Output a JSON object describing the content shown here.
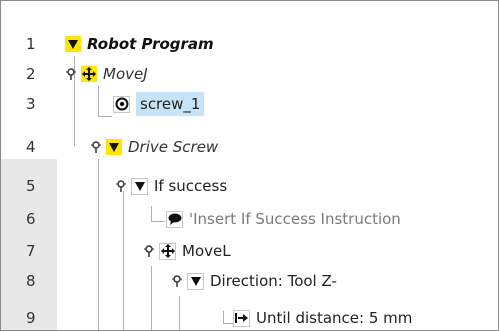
{
  "tree": {
    "rows": [
      {
        "num": "1",
        "label": "Robot Program",
        "icon": "triangle-down-icon"
      },
      {
        "num": "2",
        "label": "MoveJ",
        "icon": "move-arrows-icon"
      },
      {
        "num": "3",
        "label": "screw_1",
        "icon": "waypoint-icon"
      },
      {
        "num": "4",
        "label": "Drive Screw",
        "icon": "triangle-down-icon"
      },
      {
        "num": "5",
        "label": "If success",
        "icon": "triangle-down-icon"
      },
      {
        "num": "6",
        "label": "'Insert If Success Instruction",
        "icon": "comment-icon"
      },
      {
        "num": "7",
        "label": "MoveL",
        "icon": "move-arrows-icon"
      },
      {
        "num": "8",
        "label": "Direction: Tool Z-",
        "icon": "triangle-down-icon"
      },
      {
        "num": "9",
        "label": "Until distance: 5 mm",
        "icon": "until-arrow-icon"
      }
    ],
    "selected_row": "3"
  },
  "colors": {
    "accent_yellow": "#ffe600",
    "selection": "#c7e3f7",
    "gutter_shade": "#e8e8e8"
  }
}
